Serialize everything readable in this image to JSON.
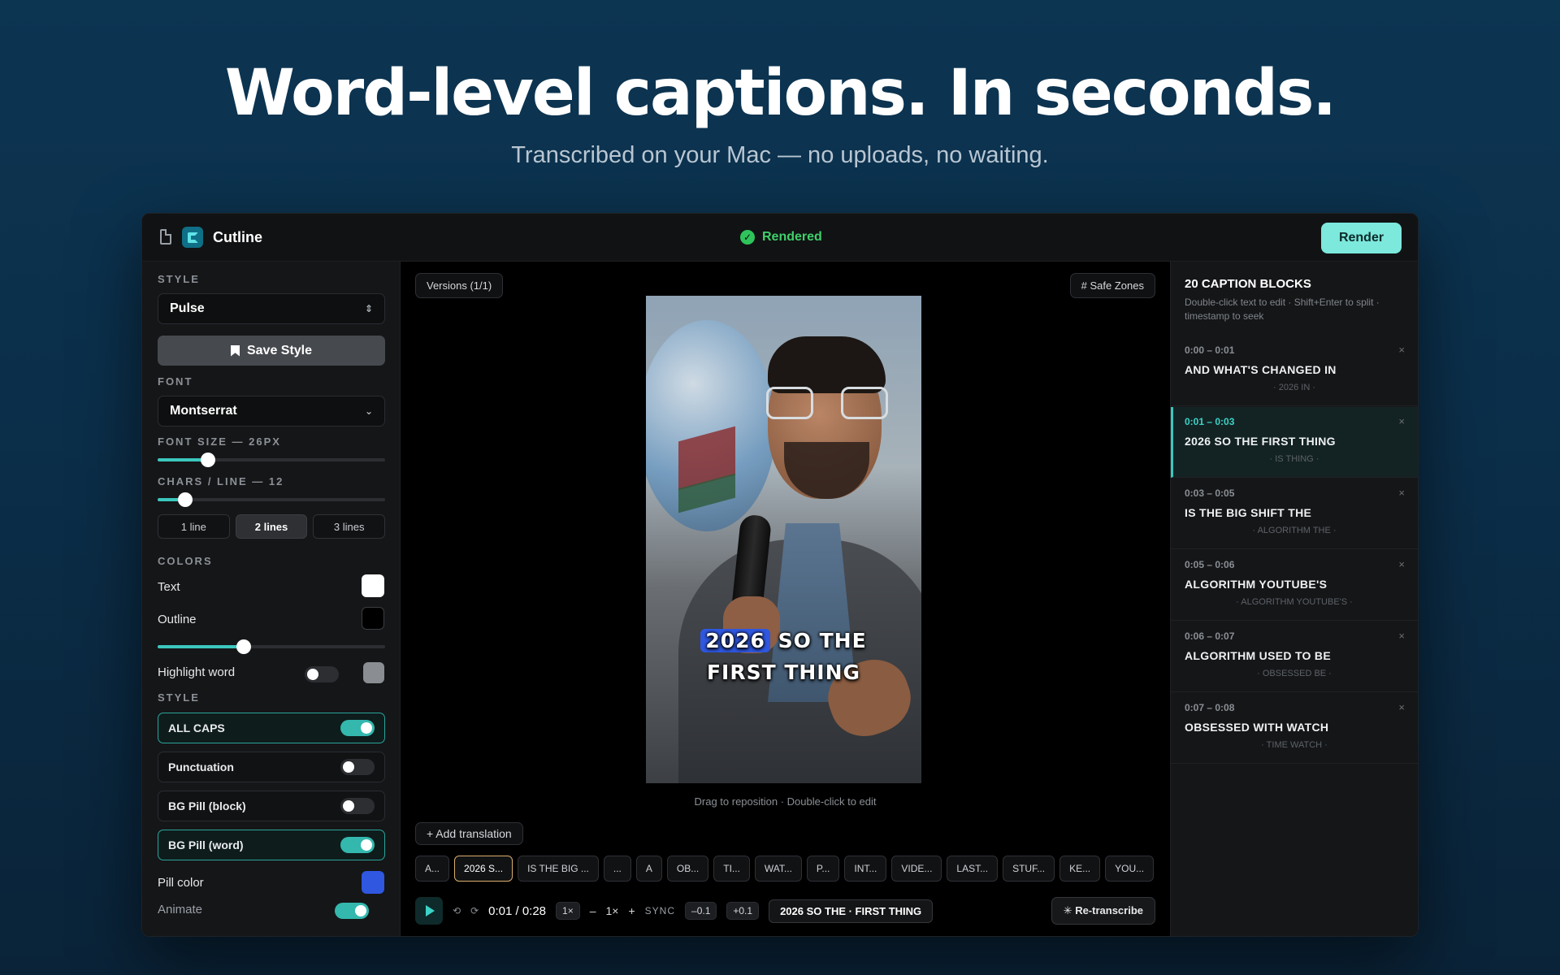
{
  "hero": {
    "title": "Word-level captions. In seconds.",
    "subtitle": "Transcribed on your Mac — no uploads, no waiting."
  },
  "app": {
    "name": "Cutline",
    "status": "Rendered",
    "render_label": "Render"
  },
  "left": {
    "style_label": "STYLE",
    "style_value": "Pulse",
    "save_style": "Save Style",
    "font_label": "FONT",
    "font_value": "Montserrat",
    "font_size_label": "FONT SIZE — 26PX",
    "font_size_level": 0.22,
    "chars_label": "CHARS / LINE — 12",
    "chars_level": 0.12,
    "lines": [
      "1 line",
      "2 lines",
      "3 lines"
    ],
    "lines_active": "2 lines",
    "colors_label": "COLORS",
    "text_label": "Text",
    "text_color": "#ffffff",
    "outline_label": "Outline",
    "outline_color": "#000000",
    "outline_level": 0.38,
    "highlight_label": "Highlight word",
    "highlight_on": false,
    "highlight_color": "#8a8d91",
    "style2_label": "STYLE",
    "options": [
      {
        "label": "ALL CAPS",
        "on": true
      },
      {
        "label": "Punctuation",
        "on": false
      },
      {
        "label": "BG Pill (block)",
        "on": false
      },
      {
        "label": "BG Pill (word)",
        "on": true
      }
    ],
    "pill_color_label": "Pill color",
    "pill_color": "#2f57e0",
    "animate_label": "Animate",
    "animate_on": true
  },
  "center": {
    "versions": "Versions (1/1)",
    "safe_zones": "# Safe Zones",
    "caption_pill_word": "2026",
    "caption_rest": "SO THE",
    "caption_line2": "FIRST THING",
    "hint": "Drag to reposition · Double-click to edit",
    "add_translation": "+ Add translation",
    "words": [
      "A...",
      "2026 S...",
      "IS THE BIG ...",
      "...",
      "A",
      "OB...",
      "TI...",
      "WAT...",
      "P...",
      "INT...",
      "VIDE...",
      "LAST...",
      "STUF...",
      "KE...",
      "YOU..."
    ],
    "active_word": "2026 S...",
    "time": "0:01 / 0:28",
    "speed_box": "1×",
    "minus": "–",
    "speed": "1×",
    "plus": "+",
    "sync_label": "SYNC",
    "sync_minus": "–0.1",
    "sync_plus": "+0.1",
    "current_caption": "2026 SO THE · FIRST THING",
    "retranscribe": "✳ Re-transcribe"
  },
  "right": {
    "title": "20 CAPTION BLOCKS",
    "subtitle": "Double-click text to edit · Shift+Enter to split · timestamp to seek",
    "blocks": [
      {
        "time": "0:00 – 0:01",
        "text": "AND WHAT'S CHANGED IN",
        "sub": "· 2026 IN ·",
        "active": false
      },
      {
        "time": "0:01 – 0:03",
        "text": "2026 SO THE FIRST THING",
        "sub": "· IS THING ·",
        "active": true
      },
      {
        "time": "0:03 – 0:05",
        "text": "IS THE BIG SHIFT THE",
        "sub": "· ALGORITHM THE ·",
        "active": false
      },
      {
        "time": "0:05 – 0:06",
        "text": "ALGORITHM YOUTUBE'S",
        "sub": "· ALGORITHM YOUTUBE'S ·",
        "active": false
      },
      {
        "time": "0:06 – 0:07",
        "text": "ALGORITHM USED TO BE",
        "sub": "· OBSESSED BE ·",
        "active": false
      },
      {
        "time": "0:07 – 0:08",
        "text": "OBSESSED WITH WATCH",
        "sub": "· TIME WATCH ·",
        "active": false
      }
    ]
  },
  "icons": {
    "doc": "document-icon",
    "logo": "cutline-logo-icon",
    "status": "check-circle-icon",
    "bookmark": "bookmark-icon",
    "play": "play-icon",
    "close": "close-icon"
  }
}
